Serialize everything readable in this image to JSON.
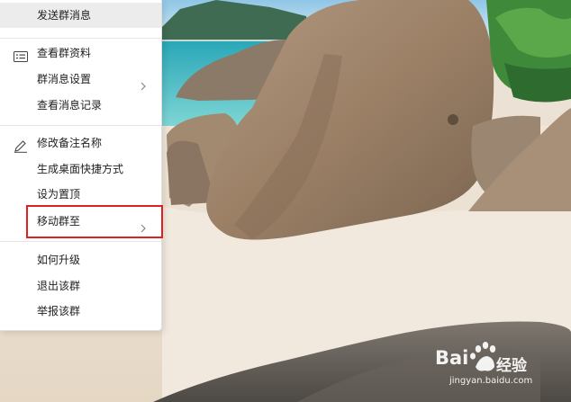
{
  "menu": {
    "items": [
      {
        "label": "发送群消息",
        "icon": "",
        "submenu": false
      },
      {
        "label": "查看群资料",
        "icon": "profile-card-icon",
        "submenu": false
      },
      {
        "label": "群消息设置",
        "icon": "",
        "submenu": true
      },
      {
        "label": "查看消息记录",
        "icon": "",
        "submenu": false
      },
      {
        "label": "修改备注名称",
        "icon": "pencil-icon",
        "submenu": false
      },
      {
        "label": "生成桌面快捷方式",
        "icon": "",
        "submenu": false
      },
      {
        "label": "设为置顶",
        "icon": "",
        "submenu": false
      },
      {
        "label": "移动群至",
        "icon": "",
        "submenu": true,
        "highlighted": true
      },
      {
        "label": "如何升级",
        "icon": "",
        "submenu": false
      },
      {
        "label": "退出该群",
        "icon": "",
        "submenu": false
      },
      {
        "label": "举报该群",
        "icon": "",
        "submenu": false
      }
    ]
  },
  "watermark": {
    "brand": "Bai",
    "brand_suffix": "经验",
    "url": "jingyan.baidu.com"
  },
  "colors": {
    "highlight_border": "#e02020",
    "menu_bg": "#ffffff",
    "hover_bg": "#ececec",
    "text": "#222222"
  }
}
